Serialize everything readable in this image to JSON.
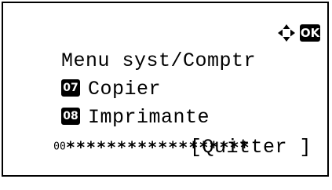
{
  "screen": {
    "title": "Menu syst/Comptr",
    "nav_icon": "four-way-arrow-icon",
    "ok_label": "OK"
  },
  "menu": {
    "items": [
      {
        "number": "07",
        "label": "Copier"
      },
      {
        "number": "08",
        "label": "Imprimante"
      }
    ],
    "masked_row": {
      "prefix": "00",
      "mask": "******************"
    }
  },
  "softkey": {
    "label": "[Quitter ]"
  }
}
